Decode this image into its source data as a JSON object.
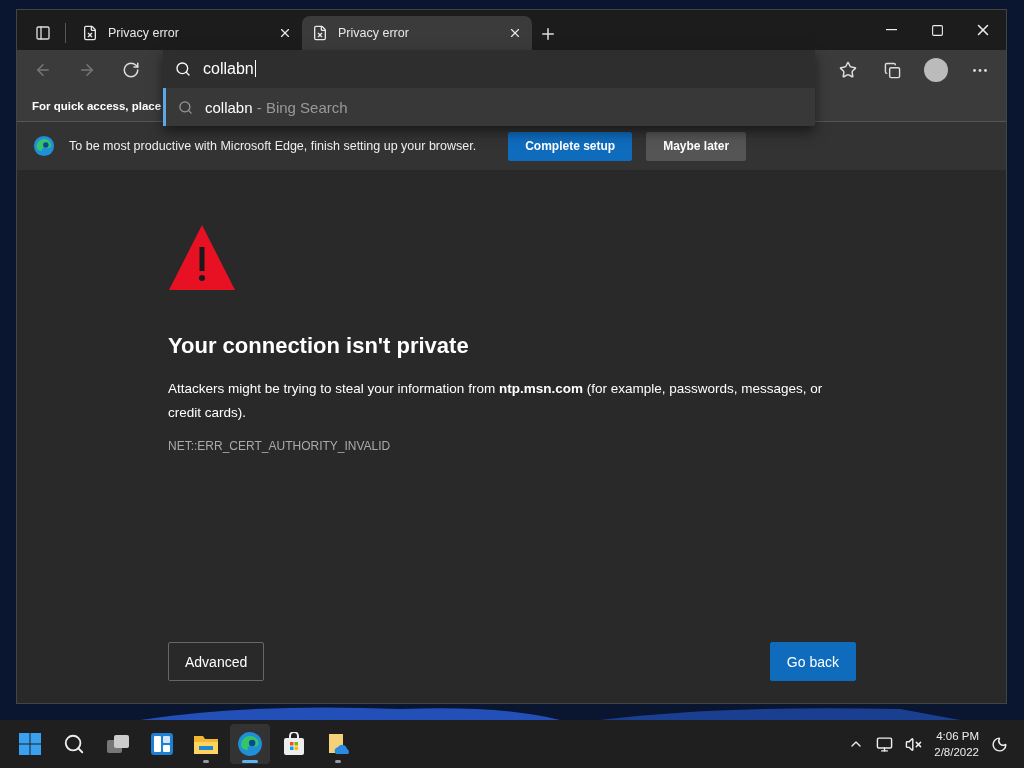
{
  "browser": {
    "tabs": [
      {
        "title": "Privacy error",
        "selected": false
      },
      {
        "title": "Privacy error",
        "selected": true
      }
    ],
    "address": {
      "value": "collabn",
      "suggestions": [
        {
          "query": "collabn",
          "source": "- Bing Search"
        }
      ]
    },
    "favorites_bar": {
      "text": "For quick access, place"
    },
    "infobar": {
      "message": "To be most productive with Microsoft Edge, finish setting up your browser.",
      "buttons": [
        {
          "label": "Complete setup",
          "kind": "primary"
        },
        {
          "label": "Maybe later",
          "kind": "secondary"
        }
      ]
    },
    "page": {
      "heading": "Your connection isn't private",
      "body": "Attackers might be trying to steal your information from **ntp.msn.com** (for example, passwords, messages, or credit cards).",
      "error_code": "NET::ERR_CERT_AUTHORITY_INVALID",
      "buttons": [
        {
          "label": "Advanced",
          "kind": "secondary"
        },
        {
          "label": "Go back",
          "kind": "primary"
        }
      ]
    }
  },
  "taskbar": {
    "apps": [
      {
        "kind": "start",
        "running": false,
        "selected": false
      },
      {
        "kind": "search",
        "running": false,
        "selected": false
      },
      {
        "kind": "taskview",
        "running": false,
        "selected": false
      },
      {
        "kind": "widgets",
        "running": false,
        "selected": false
      },
      {
        "kind": "explorer",
        "running": true,
        "selected": false
      },
      {
        "kind": "edge",
        "running": true,
        "selected": true
      },
      {
        "kind": "store",
        "running": false,
        "selected": false
      },
      {
        "kind": "onedrive",
        "running": true,
        "selected": false
      }
    ],
    "clock": {
      "time": "4:06 PM",
      "date": "2/8/2022"
    }
  }
}
